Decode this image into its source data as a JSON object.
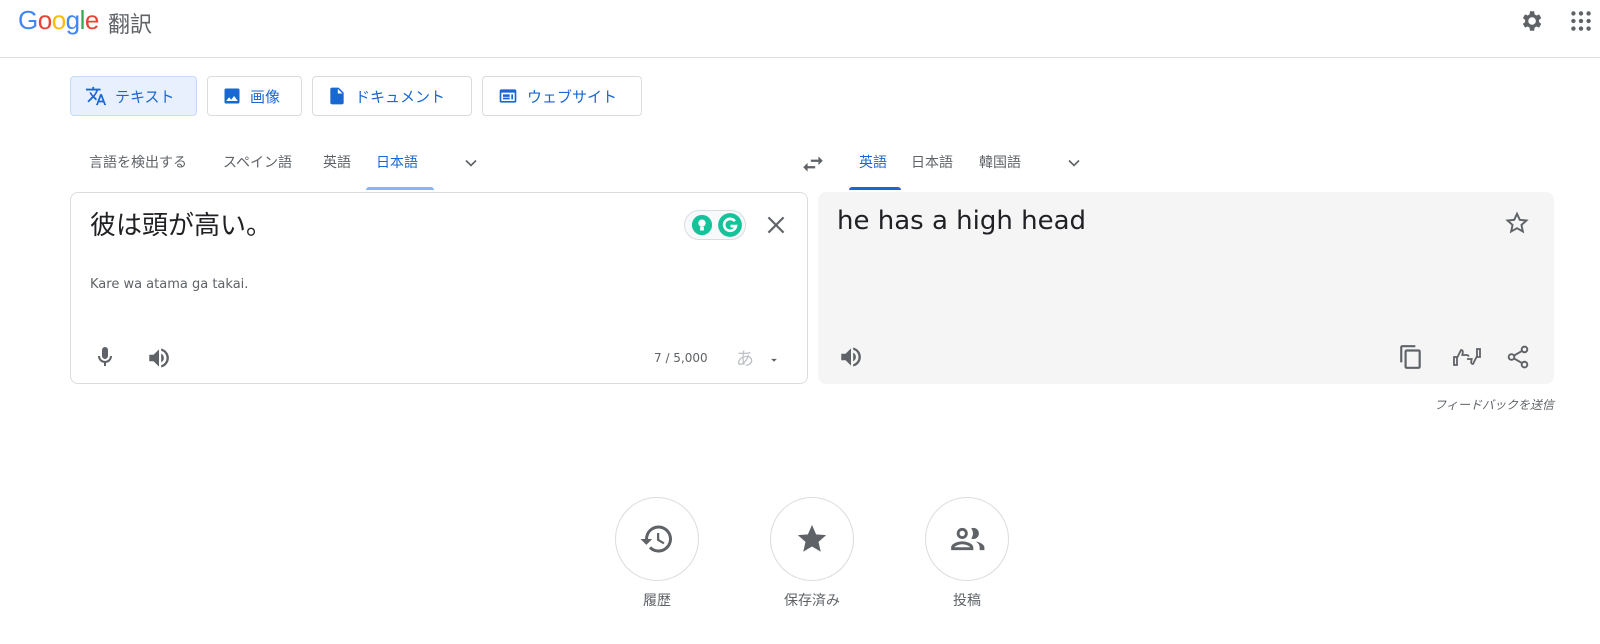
{
  "header": {
    "logo_letters": [
      "G",
      "o",
      "o",
      "g",
      "l",
      "e"
    ],
    "app_title": "翻訳"
  },
  "modes": [
    {
      "label": "テキスト",
      "icon": "translate-icon",
      "active": true
    },
    {
      "label": "画像",
      "icon": "image-icon",
      "active": false
    },
    {
      "label": "ドキュメント",
      "icon": "document-icon",
      "active": false
    },
    {
      "label": "ウェブサイト",
      "icon": "website-icon",
      "active": false
    }
  ],
  "source_langs": [
    "言語を検出する",
    "スペイン語",
    "英語",
    "日本語"
  ],
  "source_active": "日本語",
  "target_langs": [
    "英語",
    "日本語",
    "韓国語"
  ],
  "target_active": "英語",
  "source": {
    "text": "彼は頭が高い。",
    "romanization": "Kare wa atama ga takai.",
    "char_count": "7 / 5,000",
    "ime_label": "あ"
  },
  "target": {
    "text": "he has a high head"
  },
  "feedback_label": "フィードバックを送信",
  "bottom_actions": [
    {
      "label": "履歴",
      "icon": "history-icon"
    },
    {
      "label": "保存済み",
      "icon": "saved-star-icon"
    },
    {
      "label": "投稿",
      "icon": "contribute-people-icon"
    }
  ],
  "colors": {
    "accent": "#1967d2",
    "grammarly_green": "#15c39a"
  }
}
